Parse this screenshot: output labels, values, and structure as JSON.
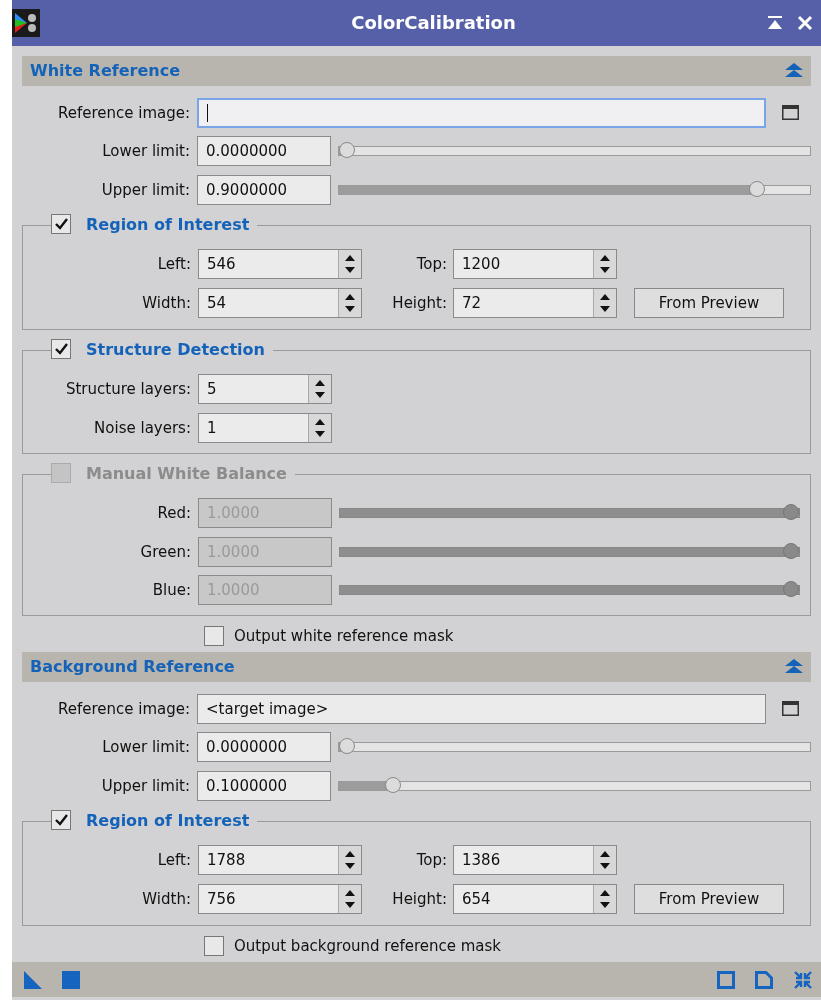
{
  "window": {
    "title": "ColorCalibration"
  },
  "sections": [
    {
      "title": "White Reference",
      "reference_image": {
        "label": "Reference image:",
        "focused": true
      },
      "limits": [
        {
          "label": "Lower limit:",
          "value": "0.0000000",
          "level": 0
        },
        {
          "label": "Upper limit:",
          "value": "0.9000000",
          "level": 0.9
        }
      ],
      "groups": [
        {
          "kind": "roi",
          "title": "Region of Interest",
          "checked": true,
          "disabled": false,
          "fields": [
            {
              "label": "Left:",
              "value": "546"
            },
            {
              "label": "Top:",
              "value": "1200"
            },
            {
              "label": "Width:",
              "value": "54"
            },
            {
              "label": "Height:",
              "value": "72"
            }
          ],
          "button": "From Preview"
        },
        {
          "kind": "spin",
          "title": "Structure Detection",
          "checked": true,
          "disabled": false,
          "fields": [
            {
              "label": "Structure layers:",
              "value": "5"
            },
            {
              "label": "Noise layers:",
              "value": "1"
            }
          ]
        },
        {
          "kind": "balance",
          "title": "Manual White Balance",
          "checked": false,
          "disabled": true,
          "channels": [
            {
              "label": "Red:",
              "value": "1.0000",
              "level": 1
            },
            {
              "label": "Green:",
              "value": "1.0000",
              "level": 1
            },
            {
              "label": "Blue:",
              "value": "1.0000",
              "level": 1
            }
          ]
        }
      ],
      "output_mask": {
        "label": "Output white reference mask",
        "checked": false
      }
    },
    {
      "title": "Background Reference",
      "reference_image": {
        "label": "Reference image:",
        "value": "<target image>",
        "focused": false
      },
      "limits": [
        {
          "label": "Lower limit:",
          "value": "0.0000000",
          "level": 0
        },
        {
          "label": "Upper limit:",
          "value": "0.1000000",
          "level": 0.1
        }
      ],
      "groups": [
        {
          "kind": "roi",
          "title": "Region of Interest",
          "checked": true,
          "disabled": false,
          "fields": [
            {
              "label": "Left:",
              "value": "1788"
            },
            {
              "label": "Top:",
              "value": "1386"
            },
            {
              "label": "Width:",
              "value": "756"
            },
            {
              "label": "Height:",
              "value": "654"
            }
          ],
          "button": "From Preview"
        }
      ],
      "output_mask": {
        "label": "Output background reference mask",
        "checked": false
      }
    }
  ]
}
